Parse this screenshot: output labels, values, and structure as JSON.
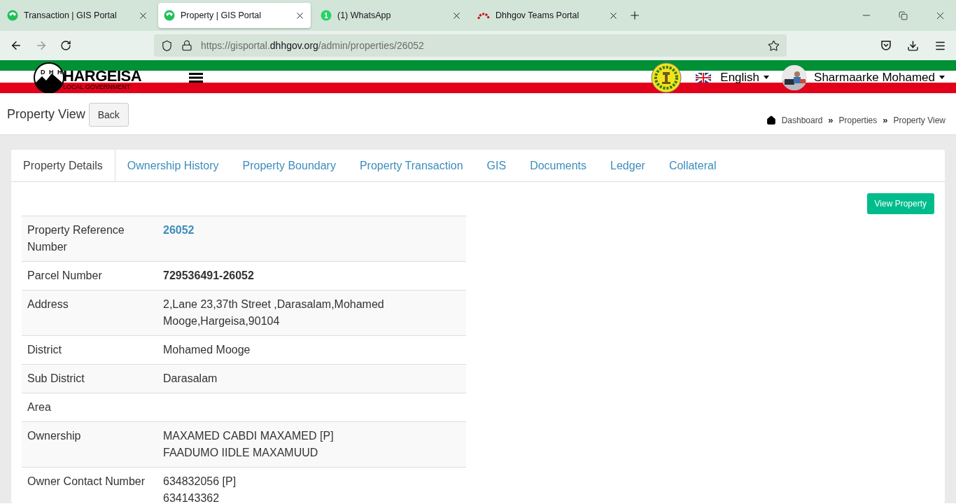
{
  "browser": {
    "tabs": [
      {
        "title": "Transaction | GIS Portal",
        "kind": "portal",
        "selected": false
      },
      {
        "title": "Property | GIS Portal",
        "kind": "portal",
        "selected": true
      },
      {
        "title": "(1) WhatsApp",
        "kind": "chat",
        "badge": "1",
        "selected": false
      },
      {
        "title": "Dhhgov Teams Portal",
        "kind": "teams",
        "selected": false
      }
    ],
    "url": {
      "prefix": "https://gisportal.",
      "domain": "dhhgov.org",
      "path": "/admin/properties/26052"
    }
  },
  "header": {
    "logo_title": "HARGEISA",
    "logo_subtitle": "LOCAL GOVERNMENT",
    "logo_letters": [
      "D",
      "H",
      "H"
    ],
    "language": "English",
    "user": "Sharmaarke Mohamed"
  },
  "page": {
    "title": "Property View",
    "back": "Back",
    "breadcrumbs": [
      "Dashboard",
      "Properties",
      "Property View"
    ],
    "separator": "»"
  },
  "tabs": [
    {
      "label": "Property Details",
      "selected": true
    },
    {
      "label": "Ownership History",
      "selected": false
    },
    {
      "label": "Property Boundary",
      "selected": false
    },
    {
      "label": "Property Transaction",
      "selected": false
    },
    {
      "label": "GIS",
      "selected": false
    },
    {
      "label": "Documents",
      "selected": false
    },
    {
      "label": "Ledger",
      "selected": false
    },
    {
      "label": "Collateral",
      "selected": false
    }
  ],
  "view_button": "View Property",
  "details": [
    {
      "label": "Property Reference Number",
      "kind": "link",
      "lines": [
        "26052"
      ]
    },
    {
      "label": "Parcel Number",
      "kind": "bold",
      "lines": [
        "729536491-26052"
      ]
    },
    {
      "label": "Address",
      "kind": "text",
      "lines": [
        "2,Lane 23,37th Street ,Darasalam,Mohamed Mooge,Hargeisa,90104"
      ]
    },
    {
      "label": "District",
      "kind": "text",
      "lines": [
        "Mohamed Mooge"
      ]
    },
    {
      "label": "Sub District",
      "kind": "text",
      "lines": [
        "Darasalam"
      ]
    },
    {
      "label": "Area",
      "kind": "text"
    },
    {
      "label": "Ownership",
      "kind": "text",
      "lines": [
        "MAXAMED CABDI MAXAMED [P]",
        "FAADUMO IIDLE MAXAMUUD"
      ]
    },
    {
      "label": "Owner Contact Number",
      "kind": "text",
      "lines": [
        "634832056 [P]",
        "634143362"
      ]
    }
  ]
}
